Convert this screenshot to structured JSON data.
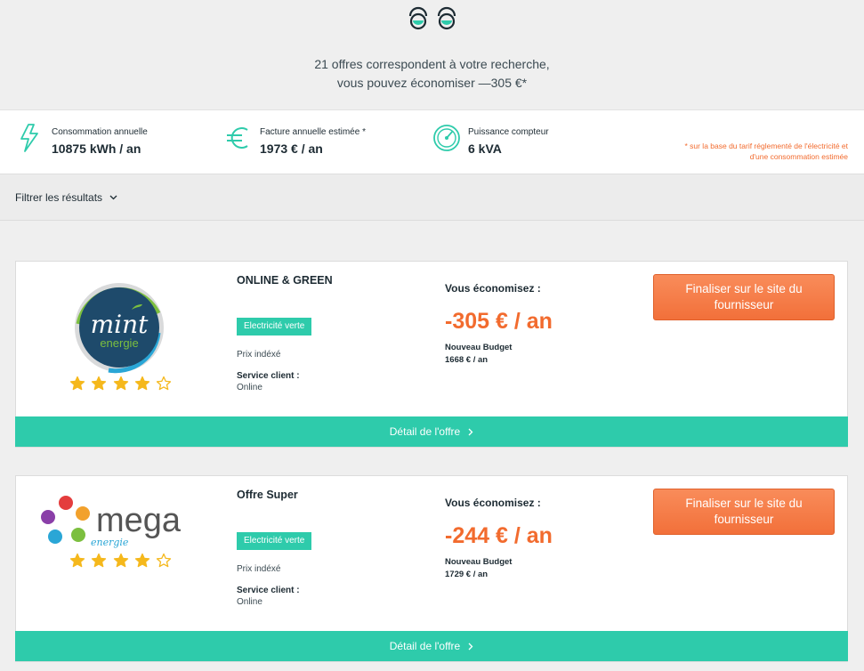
{
  "hero": {
    "line1": "21 offres correspondent à votre recherche,",
    "line2": "vous pouvez économiser —305 €*"
  },
  "summary": {
    "items": [
      {
        "label": "Consommation annuelle",
        "value": "10875 kWh / an",
        "icon": "lightning-icon"
      },
      {
        "label": "Facture annuelle estimée *",
        "value": "1973 € / an",
        "icon": "euro-icon"
      },
      {
        "label": "Puissance compteur",
        "value": "6 kVA",
        "icon": "gauge-icon"
      }
    ],
    "footnote_line1": "* sur la base du tarif réglementé de l'électricité et",
    "footnote_line2": "d'une consommation estimée"
  },
  "filter": {
    "label": "Filtrer les résultats"
  },
  "offers": [
    {
      "name": "ONLINE & GREEN",
      "logo_text_top": "mint",
      "logo_text_bottom": "energie",
      "rating": 4,
      "rating_max": 5,
      "badge": "Electricité verte",
      "prix": "Prix indéxé",
      "service_label": "Service client :",
      "service_value": "Online",
      "economy_label": "Vous économisez :",
      "economy_value": "-305 € / an",
      "budget_label": "Nouveau Budget",
      "budget_value": "1668 € / an",
      "cta": "Finaliser sur le site du fournisseur",
      "detail": "Détail de l'offre"
    },
    {
      "name": "Offre Super",
      "logo_text_top": "mega",
      "logo_text_bottom": "energie",
      "rating": 4,
      "rating_max": 5,
      "badge": "Electricité verte",
      "prix": "Prix indéxé",
      "service_label": "Service client :",
      "service_value": "Online",
      "economy_label": "Vous économisez :",
      "economy_value": "-244 € / an",
      "budget_label": "Nouveau Budget",
      "budget_value": "1729 € / an",
      "cta": "Finaliser sur le site du fournisseur",
      "detail": "Détail de l'offre"
    }
  ],
  "colors": {
    "accent_green": "#2ecbab",
    "accent_orange": "#f26b2e",
    "text_dark": "#1d2b33",
    "star_gold": "#f5b81c"
  }
}
